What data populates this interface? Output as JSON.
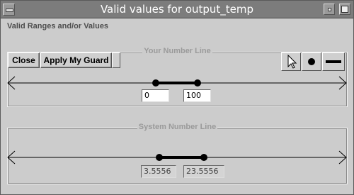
{
  "window": {
    "title": "Valid values for output_temp"
  },
  "ranges_label": "Valid Ranges and/or Values",
  "your_number_line": {
    "title": "Your Number Line",
    "close_label": "Close",
    "apply_label": "Apply My Guard",
    "tools": [
      "arrow-pointer-tool",
      "point-tool",
      "line-segment-tool"
    ],
    "min_value": "0",
    "max_value": "100"
  },
  "system_number_line": {
    "title": "System Number Line",
    "min_value": "3.5556",
    "max_value": "23.5556"
  }
}
